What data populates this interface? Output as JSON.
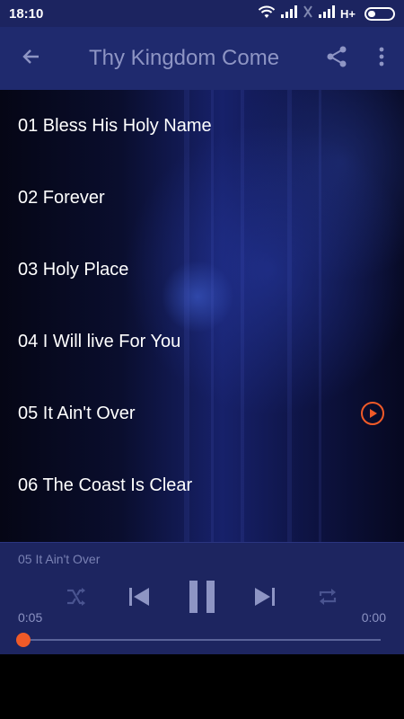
{
  "status_bar": {
    "time": "18:10",
    "network": "H+",
    "icons": [
      "wifi-icon",
      "signal-icon",
      "sim-icon",
      "signal-icon",
      "battery-icon"
    ]
  },
  "app_bar": {
    "title": "Thy Kingdom Come",
    "icons": [
      "back-arrow-icon",
      "share-icon",
      "more-vert-icon"
    ]
  },
  "tracks": [
    {
      "title": "01 Bless His Holy Name",
      "playing": false
    },
    {
      "title": "02 Forever",
      "playing": false
    },
    {
      "title": "03 Holy Place",
      "playing": false
    },
    {
      "title": "04 I Will live For You",
      "playing": false
    },
    {
      "title": "05 It Ain't Over",
      "playing": true
    },
    {
      "title": "06 The Coast Is Clear",
      "playing": false
    }
  ],
  "player": {
    "now_playing": "05 It Ain't Over",
    "current_time": "0:05",
    "total_time": "0:00",
    "progress": 0.0,
    "controls": [
      "shuffle-icon",
      "previous-icon",
      "pause-icon",
      "next-icon",
      "repeat-icon"
    ]
  },
  "colors": {
    "accent": "#f05a28",
    "app_bar": "#1f2a6e",
    "status_bar": "#1c2460",
    "player_bg": "#1d2560",
    "title_text": "#8e95c4"
  }
}
